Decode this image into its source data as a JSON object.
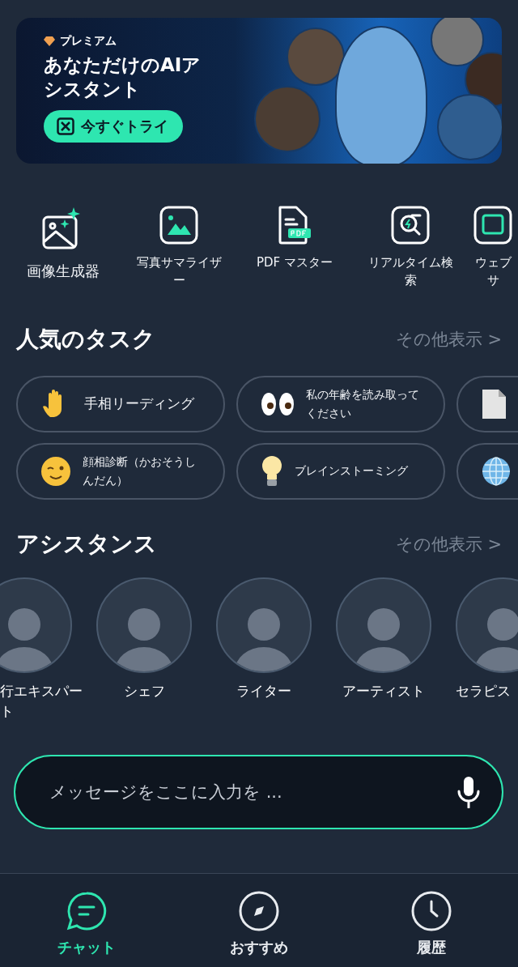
{
  "banner": {
    "badge": "プレミアム",
    "title": "あなただけのAIアシスタント",
    "button": "今すぐトライ"
  },
  "tools": [
    {
      "label": "画像生成器",
      "kind": "sparkle-image"
    },
    {
      "label": "写真サマライザー",
      "kind": "image"
    },
    {
      "label": "PDF マスター",
      "kind": "pdf"
    },
    {
      "label": "リアルタイム検索",
      "kind": "search"
    },
    {
      "label": "ウェブサ",
      "kind": "web"
    }
  ],
  "tasks": {
    "title": "人気のタスク",
    "more": "その他表示 >",
    "rows": [
      [
        {
          "label": "手相リーディング",
          "kind": "hand"
        },
        {
          "label": "私の年齢を読み取ってください",
          "kind": "eyes"
        },
        {
          "kind": "document"
        }
      ],
      [
        {
          "label": "顔相診断（かおそうしんだん）",
          "kind": "wink"
        },
        {
          "label": "ブレインストーミング",
          "kind": "bulb"
        },
        {
          "kind": "globe"
        }
      ]
    ]
  },
  "assistants": {
    "title": "アシスタンス",
    "more": "その他表示 >",
    "items": [
      {
        "name": "行エキスパート"
      },
      {
        "name": "シェフ"
      },
      {
        "name": "ライター"
      },
      {
        "name": "アーティスト"
      },
      {
        "name": "セラピス"
      }
    ]
  },
  "input": {
    "placeholder": "メッセージをここに入力を ..."
  },
  "nav": [
    {
      "label": "チャット",
      "kind": "chat",
      "selected": true
    },
    {
      "label": "おすすめ",
      "kind": "compass",
      "selected": false
    },
    {
      "label": "履歴",
      "kind": "clock",
      "selected": false
    }
  ]
}
